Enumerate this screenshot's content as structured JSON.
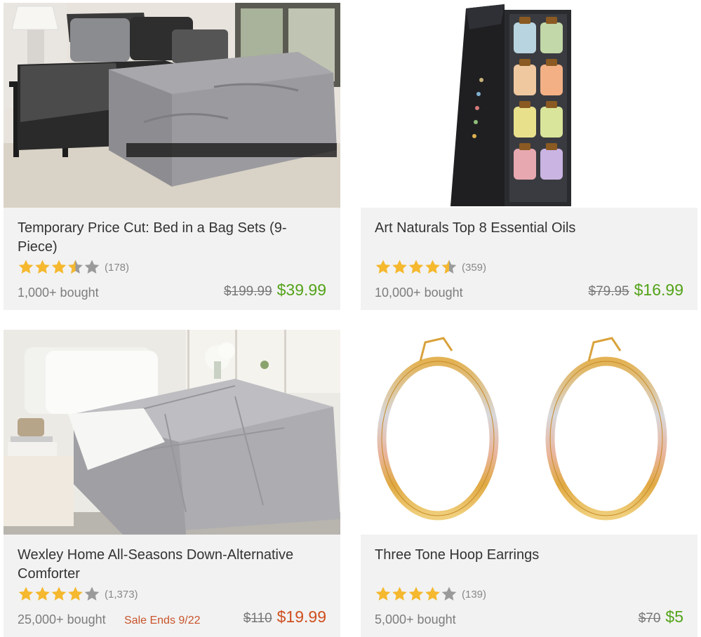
{
  "colors": {
    "star": "#f5b82e",
    "star_empty": "#9a9a9a",
    "price_green": "#53a318",
    "price_orange": "#cf4f1e",
    "sale_text": "#c9542b"
  },
  "products": [
    {
      "title": "Temporary Price Cut: Bed in a Bag Sets (9-Piece)",
      "rating": 3.5,
      "count": "(178)",
      "bought": "1,000+ bought",
      "old_price": "$199.99",
      "price": "$39.99",
      "price_color": "green",
      "sale": "",
      "image": "gray-comforter-bedroom"
    },
    {
      "title": "Art Naturals Top 8 Essential Oils",
      "rating": 4.5,
      "count": "(359)",
      "bought": "10,000+ bought",
      "old_price": "$79.95",
      "price": "$16.99",
      "price_color": "green",
      "sale": "",
      "image": "essential-oils-box"
    },
    {
      "title": "Wexley Home All-Seasons Down-Alternative Comforter",
      "rating": 4,
      "count": "(1,373)",
      "bought": "25,000+ bought",
      "old_price": "$110",
      "price": "$19.99",
      "price_color": "orange",
      "sale": "Sale Ends 9/22",
      "image": "white-gray-comforter"
    },
    {
      "title": "Three Tone Hoop Earrings",
      "rating": 4,
      "count": "(139)",
      "bought": "5,000+ bought",
      "old_price": "$70",
      "price": "$5",
      "price_color": "green",
      "sale": "",
      "image": "hoop-earrings"
    }
  ]
}
